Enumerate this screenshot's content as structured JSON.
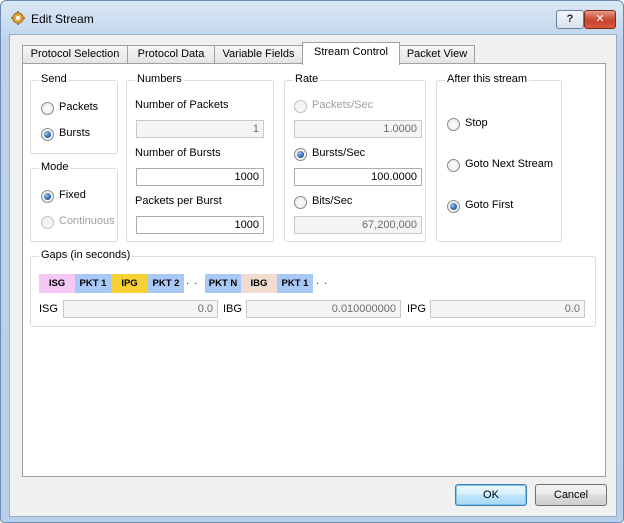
{
  "window": {
    "title": "Edit Stream",
    "help_label": "?",
    "close_label": "✕"
  },
  "tabs": [
    {
      "label": "Protocol Selection"
    },
    {
      "label": "Protocol Data"
    },
    {
      "label": "Variable Fields"
    },
    {
      "label": "Stream Control",
      "active": true
    },
    {
      "label": "Packet View"
    }
  ],
  "send": {
    "title": "Send",
    "options": [
      {
        "label": "Packets",
        "checked": false
      },
      {
        "label": "Bursts",
        "checked": true
      }
    ]
  },
  "mode": {
    "title": "Mode",
    "options": [
      {
        "label": "Fixed",
        "checked": true
      },
      {
        "label": "Continuous",
        "checked": false,
        "disabled": true
      }
    ]
  },
  "numbers": {
    "title": "Numbers",
    "num_packets_label": "Number of Packets",
    "num_packets_value": "1",
    "num_bursts_label": "Number of Bursts",
    "num_bursts_value": "1000",
    "packets_per_burst_label": "Packets per Burst",
    "packets_per_burst_value": "1000"
  },
  "rate": {
    "title": "Rate",
    "packets_sec_label": "Packets/Sec",
    "packets_sec_value": "1.0000",
    "bursts_sec_label": "Bursts/Sec",
    "bursts_sec_value": "100.0000",
    "bits_sec_label": "Bits/Sec",
    "bits_sec_value": "67,200,000"
  },
  "after": {
    "title": "After this stream",
    "options": [
      {
        "label": "Stop",
        "checked": false
      },
      {
        "label": "Goto Next Stream",
        "checked": false
      },
      {
        "label": "Goto First",
        "checked": true
      }
    ]
  },
  "gaps": {
    "title": "Gaps (in seconds)",
    "diagram": [
      {
        "label": "ISG",
        "color": "#f4c7f4"
      },
      {
        "label": "PKT 1",
        "color": "#a8c8f5"
      },
      {
        "label": "IPG",
        "color": "#f7d033"
      },
      {
        "label": "PKT 2",
        "color": "#a8c8f5"
      },
      {
        "label": "· · ·",
        "color": ""
      },
      {
        "label": "PKT N",
        "color": "#a8c8f5"
      },
      {
        "label": "IBG",
        "color": "#f1dccf"
      },
      {
        "label": "PKT 1",
        "color": "#a8c8f5"
      },
      {
        "label": "· · ·",
        "color": ""
      }
    ],
    "isg_label": "ISG",
    "isg_value": "0.0",
    "ibg_label": "IBG",
    "ibg_value": "0.010000000",
    "ipg_label": "IPG",
    "ipg_value": "0.0"
  },
  "buttons": {
    "ok_label": "OK",
    "cancel_label": "Cancel"
  }
}
